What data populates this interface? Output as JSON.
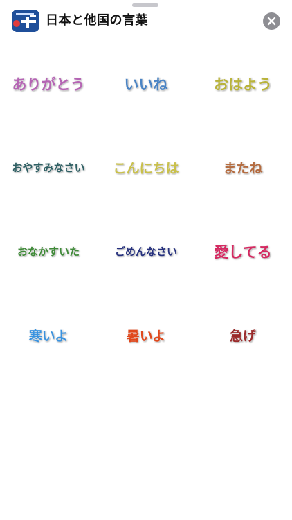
{
  "header": {
    "title": "日本と他国の言葉",
    "icon": "app-logo-icon",
    "close_icon": "close-icon"
  },
  "colors": {
    "icon_background": "#1f4f9a",
    "close_background": "#8e8e93"
  },
  "stickers": [
    {
      "text": "ありがとう",
      "color": "#b565b4"
    },
    {
      "text": "いいね",
      "color": "#4b84c4"
    },
    {
      "text": "おはよう",
      "color": "#b9b33a"
    },
    {
      "text": "おやすみなさい",
      "color": "#2f6064"
    },
    {
      "text": "こんにちは",
      "color": "#c9c04a"
    },
    {
      "text": "またね",
      "color": "#b46b3f"
    },
    {
      "text": "おなかすいた",
      "color": "#3f8a38"
    },
    {
      "text": "ごめんなさい",
      "color": "#25307d"
    },
    {
      "text": "愛してる",
      "color": "#d42a61"
    },
    {
      "text": "寒いよ",
      "color": "#3b93df"
    },
    {
      "text": "暑いよ",
      "color": "#e0481c"
    },
    {
      "text": "急げ",
      "color": "#9a2a2a"
    }
  ]
}
